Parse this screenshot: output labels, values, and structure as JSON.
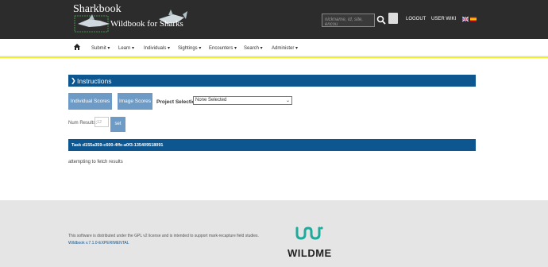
{
  "header": {
    "title": "Sharkbook",
    "subtitle": "Wildbook for Sharks",
    "search_placeholder": "nickname, id, site, encou",
    "logout": "LOGOUT",
    "user_wiki": "USER WIKI"
  },
  "nav": {
    "items": [
      "Submit",
      "Learn",
      "Individuals",
      "Sightings",
      "Encounters",
      "Search",
      "Administer"
    ]
  },
  "main": {
    "instructions_label": "Instructions",
    "individual_scores": "Individual Scores",
    "image_scores": "Image Scores",
    "project_label": "Project Selection",
    "project_value": "None Selected",
    "num_results_label": "Num Results:",
    "num_results_placeholder": "12",
    "set_label": "set",
    "task_label": "Task d155a359-c600-4ffe-a0f3-135409518091",
    "fetch_text": "attempting to fetch results"
  },
  "footer": {
    "license_text": "This software is distributed under the GPL v2 license and is intended to support mark-recapture field studies.",
    "version_link": "Wildbook v.7.1.0-EXPERIMENTAL",
    "brand": "WILDME"
  },
  "colors": {
    "header_bg": "#2c2c2c",
    "primary_bar": "#0d5690",
    "button": "#6d9bc6",
    "accent_line": "#f1ef2a",
    "logo_teal": "#1faa9b"
  }
}
